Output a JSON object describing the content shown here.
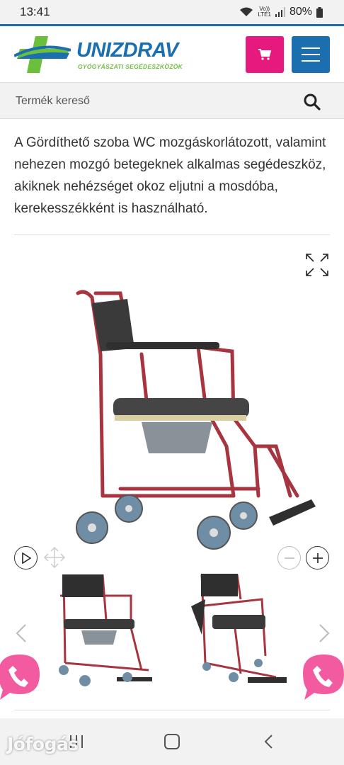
{
  "status_bar": {
    "time": "13:41",
    "network_top": "Vo))",
    "network_bottom": "LTE1",
    "battery": "80%"
  },
  "header": {
    "brand": "UNIZDRAV",
    "tagline": "GYÓGYÁSZATI SEGÉDESZKÖZÖK",
    "cart_icon": "cart-icon",
    "menu_icon": "hamburger-menu-icon",
    "colors": {
      "brand_blue": "#1b6fae",
      "brand_green": "#6abf3b",
      "cart_pink": "#e6197e"
    }
  },
  "search": {
    "placeholder": "Termék kereső",
    "icon": "search-icon"
  },
  "product": {
    "description": "A Gördíthető szoba WC mozgáskorlátozott, valamint nehezen mozgó betegeknek alkalmas segédeszköz, akiknek nehézséget okoz eljutni a mosdóba, kerekesszékként is használható.",
    "image_alt": "Gördíthető szoba WC"
  },
  "gallery_controls": {
    "expand_icon": "fullscreen-expand-icon",
    "play_icon": "play-icon",
    "move_icon": "move-arrows-icon",
    "zoom_out_icon": "zoom-out-icon",
    "zoom_in_icon": "zoom-in-icon",
    "prev_icon": "chevron-left-icon",
    "next_icon": "chevron-right-icon"
  },
  "floating": {
    "phone_icon": "phone-icon",
    "color": "#f25ba0"
  },
  "system_nav": {
    "recent_icon": "recent-apps-icon",
    "home_icon": "home-icon",
    "back_icon": "back-icon"
  },
  "watermark": "Jófogás"
}
